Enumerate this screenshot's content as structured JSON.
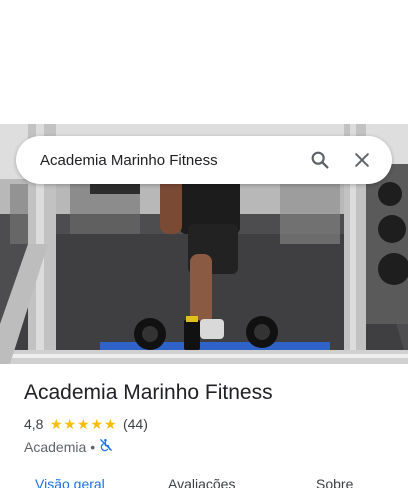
{
  "search": {
    "query": "Academia Marinho Fitness",
    "search_icon": "search-icon",
    "clear_icon": "close-icon"
  },
  "place": {
    "name": "Academia Marinho Fitness",
    "rating": "4,8",
    "stars": 5,
    "star_glyph": "★",
    "reviews": "(44)",
    "category": "Academia",
    "separator": "•",
    "accessibility_icon": "not-accessible-icon"
  },
  "tabs": [
    {
      "label": "Visão geral",
      "active": true
    },
    {
      "label": "Avaliações",
      "active": false
    },
    {
      "label": "Sobre",
      "active": false
    }
  ],
  "colors": {
    "accent": "#1a73e8",
    "star": "#fbbc04",
    "text": "#202124",
    "secondary_text": "#5f6368"
  }
}
